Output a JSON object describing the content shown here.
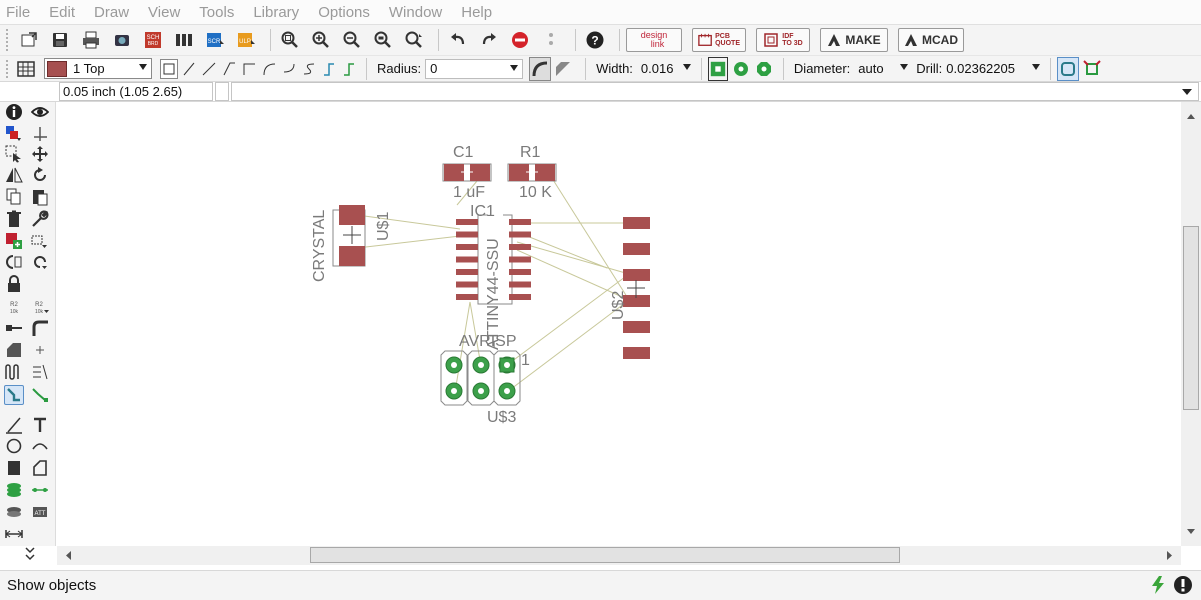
{
  "menu": [
    "File",
    "Edit",
    "Draw",
    "View",
    "Tools",
    "Library",
    "Options",
    "Window",
    "Help"
  ],
  "toolbar": {
    "buttons": [
      "open-icon",
      "save-icon",
      "print-icon",
      "cam-icon",
      "schematic-icon",
      "layers-icon",
      "scr-icon",
      "ulp-icon",
      "zoom-fit-icon",
      "zoom-in-icon",
      "zoom-out-icon",
      "zoom-select-icon",
      "zoom-redraw-icon",
      "undo-icon",
      "redo-icon",
      "stop-icon",
      "go-icon",
      "help-icon"
    ],
    "ext": {
      "design_link_top": "design",
      "design_link_bottom": "link",
      "pcb_quote_top": "PCB",
      "pcb_quote_bottom": "QUOTE",
      "idf_top": "IDF",
      "idf_bottom": "TO 3D",
      "make": "MAKE",
      "mcad": "MCAD"
    }
  },
  "params": {
    "layer": "1 Top",
    "layer_color": "#a65050",
    "radius_label": "Radius:",
    "radius_value": "0",
    "width_label": "Width:",
    "width_value": "0.016",
    "diameter_label": "Diameter:",
    "diameter_value": "auto",
    "drill_label": "Drill:",
    "drill_value": "0.02362205"
  },
  "coordinates": "0.05 inch (1.05 2.65)",
  "board": {
    "components": [
      {
        "name": "C1",
        "value": "1 uF"
      },
      {
        "name": "R1",
        "value": "10 K"
      },
      {
        "name": "IC1",
        "value": "ATTINY44-SSU"
      },
      {
        "name": "U$1",
        "value": "CRYSTAL"
      },
      {
        "name": "U$2",
        "value": ""
      },
      {
        "name": "U$3",
        "value": "AVRISP"
      }
    ],
    "pin1_label": "1",
    "pad_color": "#a85050",
    "pad_outline": "#6a2a2a",
    "airwire_color": "#c8c89a",
    "outline_color": "#8a8a8a"
  },
  "status": {
    "text": "Show objects"
  }
}
